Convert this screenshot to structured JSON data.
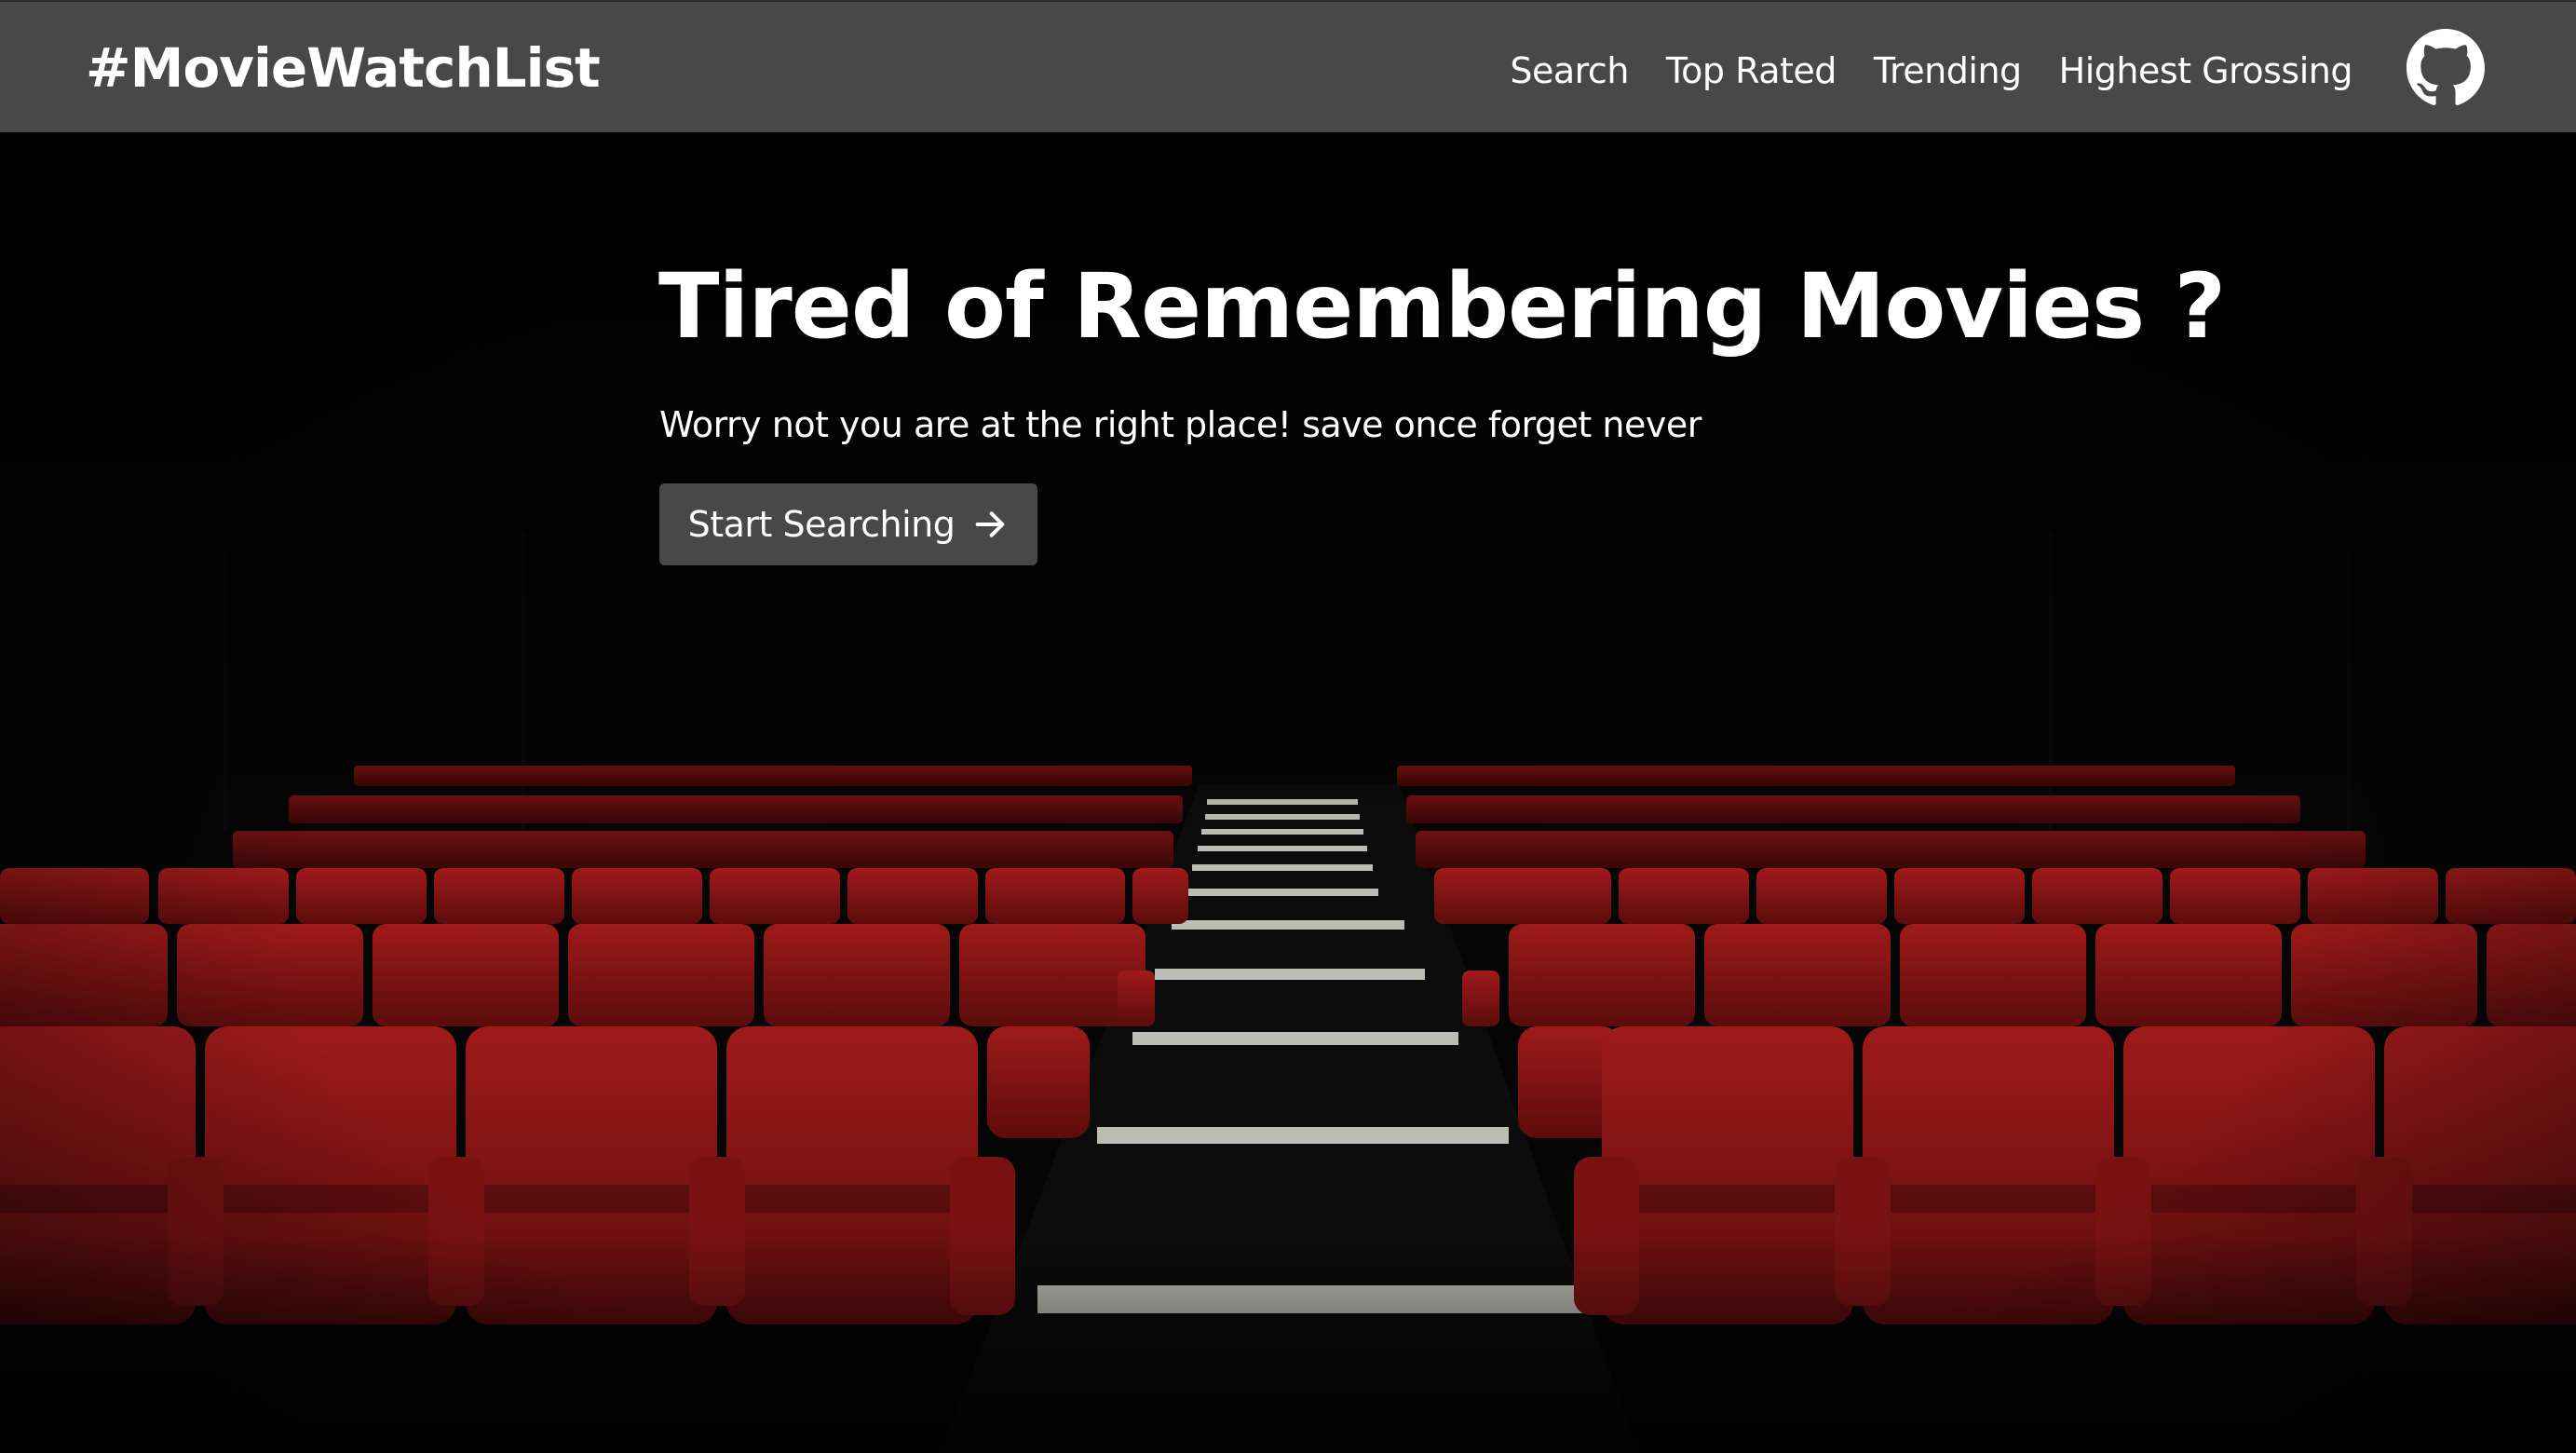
{
  "navbar": {
    "brand": "#MovieWatchList",
    "links": [
      {
        "label": "Search"
      },
      {
        "label": "Top Rated"
      },
      {
        "label": "Trending"
      },
      {
        "label": "Highest Grossing"
      }
    ],
    "github_icon": "github-icon"
  },
  "hero": {
    "title": "Tired of Remembering Movies ?",
    "subtitle": "Worry not you are at the right place! save once forget never",
    "cta_label": "Start Searching",
    "cta_icon": "arrow-right-icon",
    "background_image": "cinema-seats"
  },
  "colors": {
    "navbar_bg": "#484848",
    "button_bg": "#484848",
    "text": "#ffffff",
    "seat_red": "#8e1717",
    "background": "#000000"
  }
}
